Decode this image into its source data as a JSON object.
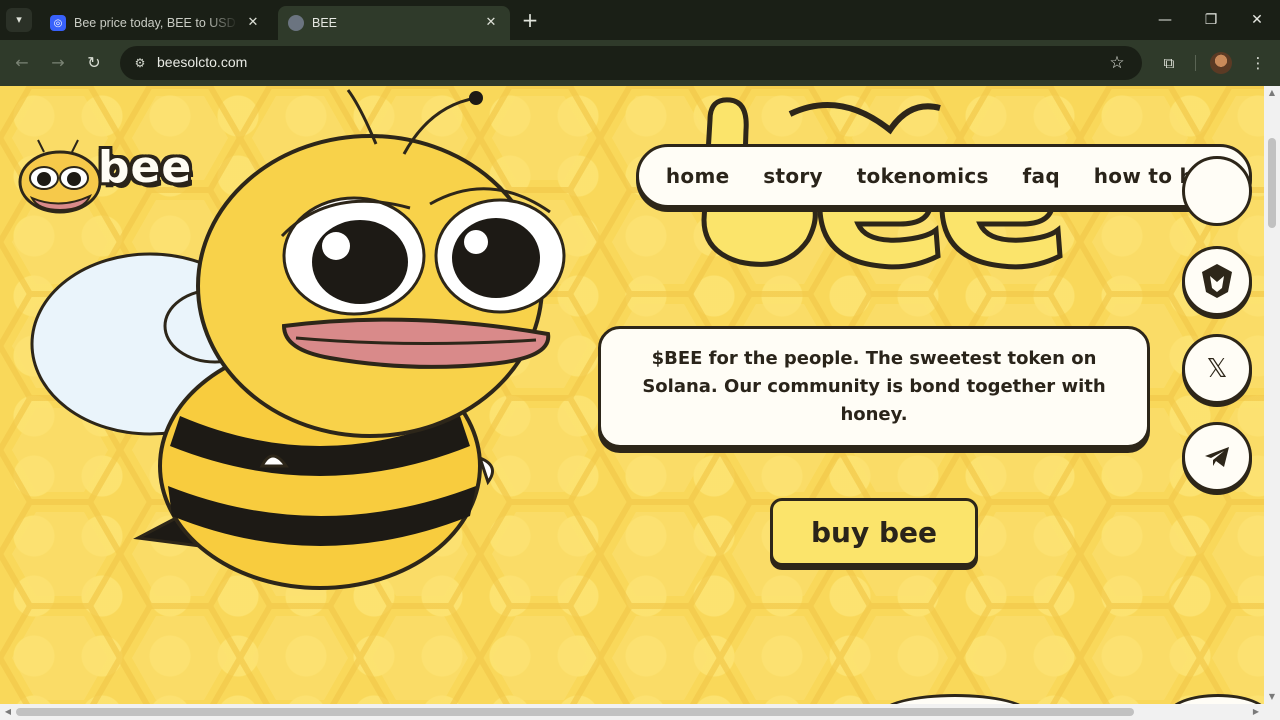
{
  "browser": {
    "tabs": [
      {
        "title": "Bee price today, BEE to USD live",
        "active": false,
        "favicon": "coinmarketcap-icon"
      },
      {
        "title": "BEE",
        "active": true,
        "favicon": "globe-icon"
      }
    ],
    "url": "beesolcto.com",
    "accent_color": "#2f3a2a"
  },
  "site": {
    "logo_text": "bee",
    "hero_title": "bee",
    "nav": [
      {
        "label": "home"
      },
      {
        "label": "story"
      },
      {
        "label": "tokenomics"
      },
      {
        "label": "faq"
      },
      {
        "label": "how to buy"
      }
    ],
    "description": "$BEE for the people. The sweetest token on Solana. Our community is bond together with honey.",
    "buy_button": "buy bee",
    "socials": [
      "dextools-icon",
      "x-icon",
      "telegram-icon"
    ],
    "colors": {
      "background": "#f9d85a",
      "outline": "#2d2619",
      "panel": "#fffdf6",
      "button": "#fbe46b"
    }
  }
}
